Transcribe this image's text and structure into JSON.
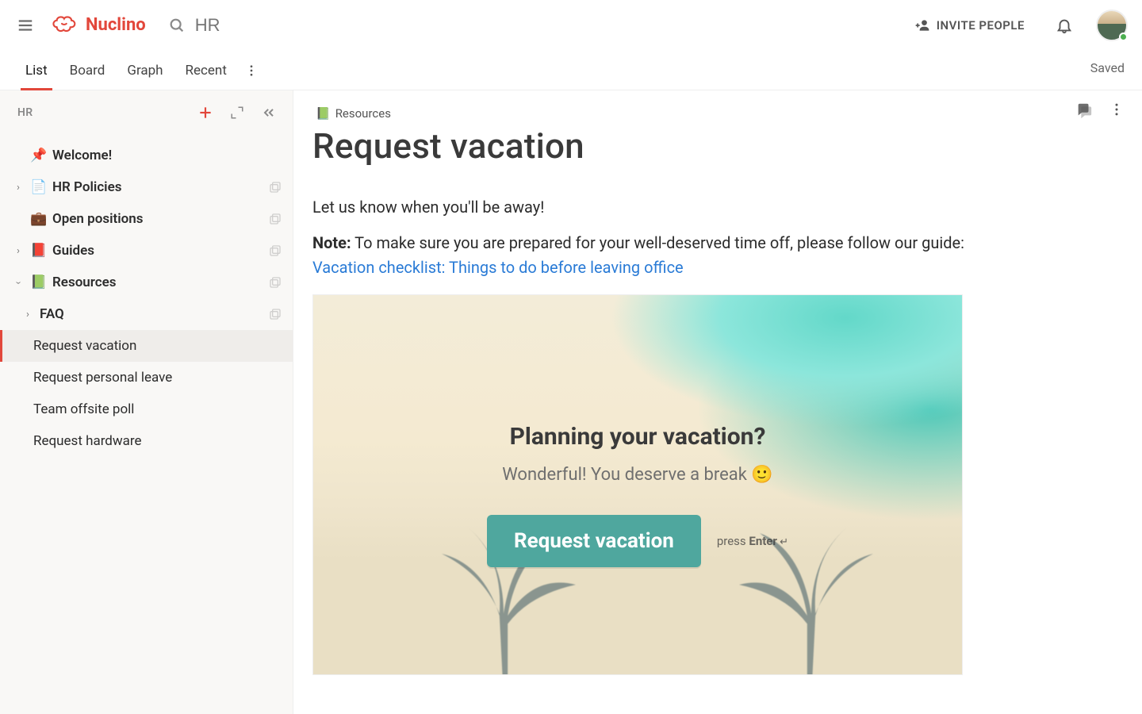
{
  "brand": {
    "name": "Nuclino",
    "color": "#e2473b"
  },
  "topbar": {
    "search_placeholder": "HR",
    "invite_label": "INVITE PEOPLE"
  },
  "tabs": {
    "items": [
      "List",
      "Board",
      "Graph",
      "Recent"
    ],
    "active_index": 0,
    "saved_label": "Saved"
  },
  "sidebar": {
    "breadcrumb": "HR",
    "welcome": {
      "icon": "📌",
      "label": "Welcome!"
    },
    "nodes": [
      {
        "icon": "📄",
        "label": "HR Policies",
        "expanded": false
      },
      {
        "icon": "💼",
        "label": "Open positions",
        "expanded": false
      },
      {
        "icon": "📕",
        "label": "Guides",
        "expanded": false
      },
      {
        "icon": "📗",
        "label": "Resources",
        "expanded": true
      }
    ],
    "resources_children": {
      "faq": {
        "label": "FAQ"
      },
      "pages": [
        "Request vacation",
        "Request personal leave",
        "Team offsite poll",
        "Request hardware"
      ],
      "selected_index": 0
    }
  },
  "doc": {
    "crumb_icon": "📗",
    "crumb_label": "Resources",
    "title": "Request vacation",
    "intro": "Let us know when you'll be away!",
    "note_label": "Note:",
    "note_text": " To make sure you are prepared for your well-deserved time off, please follow our guide: ",
    "link_text": "Vacation checklist: Things to do before leaving office",
    "embed": {
      "title": "Planning your vacation?",
      "subtitle": "Wonderful! You deserve a break 🙂",
      "cta": "Request vacation",
      "hint_prefix": "press ",
      "hint_key": "Enter",
      "hint_glyph": " ↵"
    }
  },
  "icons": {
    "menu": "menu-icon",
    "search": "search-icon",
    "person_add": "person-add-icon",
    "bell": "bell-icon",
    "more_vert": "more-vert-icon",
    "add": "plus-icon",
    "expand": "expand-icon",
    "collapse_left": "chevrons-left-icon",
    "chat": "chat-icon"
  }
}
